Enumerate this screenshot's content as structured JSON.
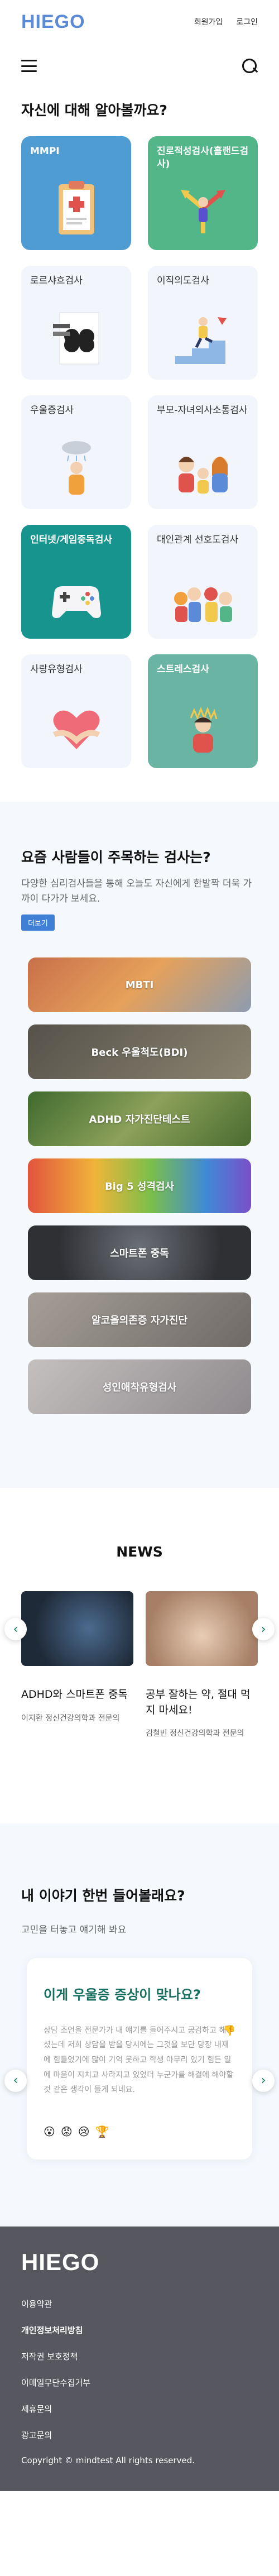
{
  "header": {
    "logo": "HIEGO",
    "signup": "회원가입",
    "login": "로그인"
  },
  "tests": {
    "heading": "자신에 대해 알아볼까요?",
    "cards": [
      {
        "label": "MMPI",
        "icon": "clipboard-icon",
        "color": "#4f9cd3"
      },
      {
        "label": "진로적성검사(홀랜드검사)",
        "icon": "crossroads-icon",
        "color": "#52b688"
      },
      {
        "label": "로르샤흐검사",
        "icon": "inkblot-icon",
        "color": "#f2f5fb"
      },
      {
        "label": "이직의도검사",
        "icon": "climber-icon",
        "color": "#f2f5fb"
      },
      {
        "label": "우울증검사",
        "icon": "sad-person-icon",
        "color": "#f2f5fb"
      },
      {
        "label": "부모-자녀의사소통검사",
        "icon": "family-icon",
        "color": "#f2f5fb"
      },
      {
        "label": "인터넷/게임중독검사",
        "icon": "gamepad-icon",
        "color": "#18948f"
      },
      {
        "label": "대인관계 선호도검사",
        "icon": "people-icon",
        "color": "#f2f5fb"
      },
      {
        "label": "사랑유형검사",
        "icon": "heart-icon",
        "color": "#f2f5fb"
      },
      {
        "label": "스트레스검사",
        "icon": "stressed-person-icon",
        "color": "#69b4a2"
      }
    ]
  },
  "popular": {
    "heading": "요즘 사람들이 주목하는 검사는?",
    "description": "다양한 심리검사들을 통해 오늘도 자신에게 한발짝 더욱 가까이 다가가 보세요.",
    "more_label": "더보기",
    "banners": [
      {
        "label": "MBTI",
        "color": "#c8704a"
      },
      {
        "label": "Beck 우울척도(BDI)",
        "color": "#6f6a5d"
      },
      {
        "label": "ADHD 자가진단테스트",
        "color": "#5e7d3a"
      },
      {
        "label": "Big 5 성격검사",
        "color": "#d6a13c"
      },
      {
        "label": "스마트폰 중독",
        "color": "#3b3b40"
      },
      {
        "label": "알코올의존증 자가진단",
        "color": "#8d8781"
      },
      {
        "label": "성인애착유형검사",
        "color": "#a3a0a2"
      }
    ]
  },
  "news": {
    "heading": "NEWS",
    "items": [
      {
        "title": "ADHD와 스마트폰 중독",
        "source": "이지환 정신건강의학과 전문의",
        "color": "#2d3a4a"
      },
      {
        "title": "공부 잘하는 약, 절대 먹지 마세요!",
        "source": "김철빈 정신건강의학과 전문의",
        "color": "#c9a78b"
      }
    ]
  },
  "story": {
    "heading": "내 이야기 한번 들어볼래요?",
    "subheading": "고민을 터놓고 얘기해 봐요",
    "card_title": "이게 우울증 증상이 맞나요?",
    "card_body": "상담 조언을 전문가가 내 얘기를 들어주시고 공감하고 해주셨는데 저희 상담을 받을 당시에는 그것을 보단 당장 내재에 힘들었기에 많이 기억 못하고 학생 아무리 있기 힘든 일에 마음이 지치고 사라지고 있었더 누군가를 해결에 해야할 것 같은 생각이 들게 되네요.",
    "reactions": [
      "😮",
      "😡",
      "😢",
      "🏆"
    ]
  },
  "footer": {
    "logo": "HIEGO",
    "links": [
      "이용약관",
      "개인정보처리방침",
      "저작권 보호정책",
      "이메일무단수집거부",
      "제휴문의",
      "광고문의"
    ],
    "copyright": "Copyright © mindtest All rights reserved."
  }
}
